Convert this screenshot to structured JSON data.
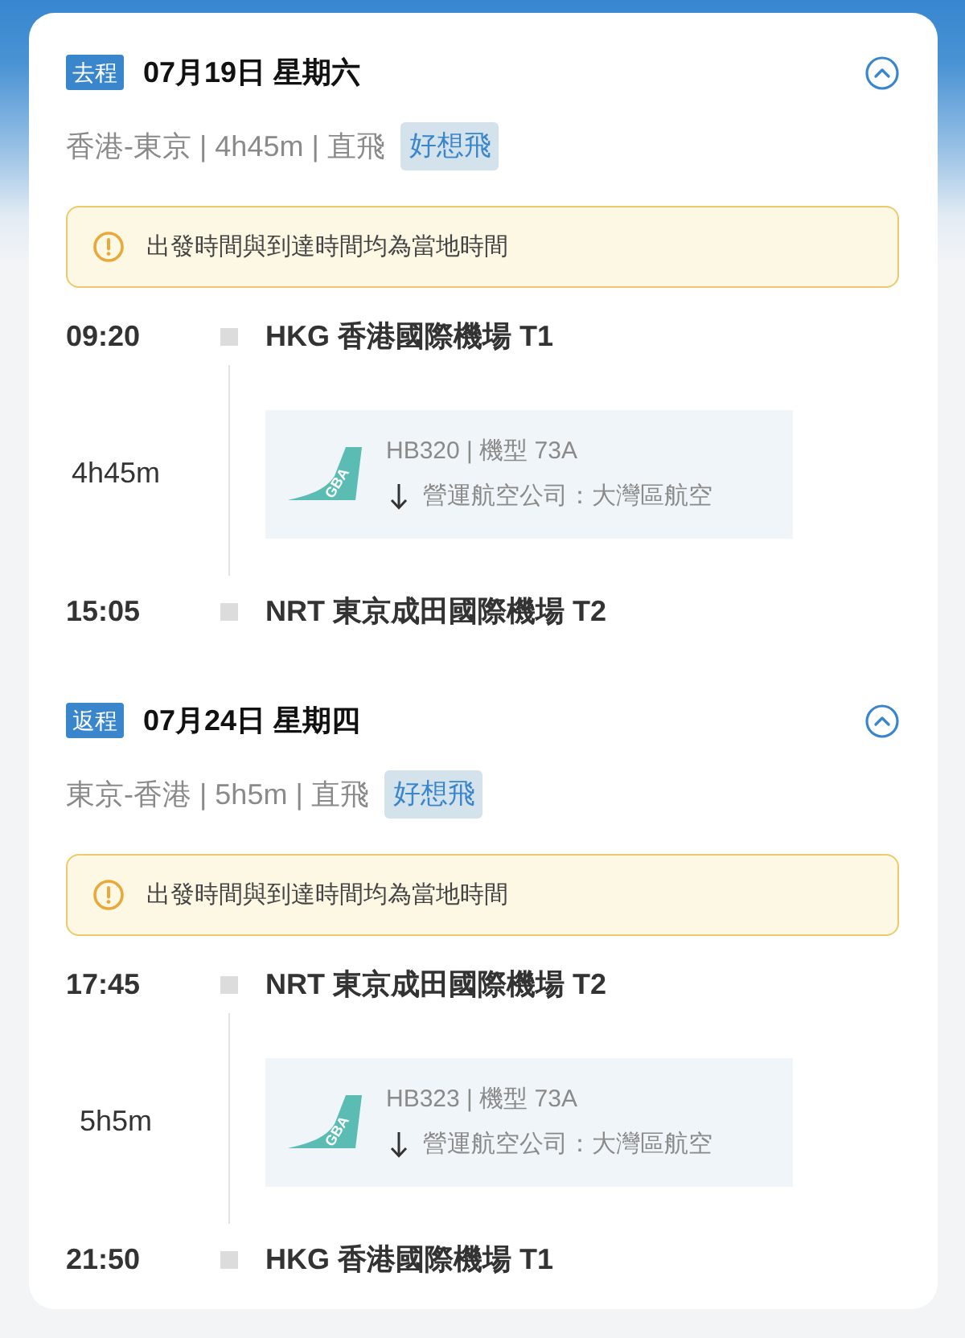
{
  "segments": [
    {
      "direction": "去程",
      "date": "07月19日 星期六",
      "expanded": true,
      "route": "香港-東京 | 4h45m | 直飛",
      "tag": "好想飛",
      "notice": "出發時間與到達時間均為當地時間",
      "departure": {
        "time": "09:20",
        "airport": "HKG 香港國際機場 T1"
      },
      "duration": "4h45m",
      "flight": {
        "airline_logo": "GBA",
        "number": "HB320 | 機型 73A",
        "operator": "營運航空公司：大灣區航空"
      },
      "arrival": {
        "time": "15:05",
        "airport": "NRT 東京成田國際機場 T2"
      }
    },
    {
      "direction": "返程",
      "date": "07月24日 星期四",
      "expanded": true,
      "route": "東京-香港 | 5h5m | 直飛",
      "tag": "好想飛",
      "notice": "出發時間與到達時間均為當地時間",
      "departure": {
        "time": "17:45",
        "airport": "NRT 東京成田國際機場 T2"
      },
      "duration": "5h5m",
      "flight": {
        "airline_logo": "GBA",
        "number": "HB323 | 機型 73A",
        "operator": "營運航空公司：大灣區航空"
      },
      "arrival": {
        "time": "21:50",
        "airport": "HKG 香港國際機場 T1"
      }
    }
  ]
}
